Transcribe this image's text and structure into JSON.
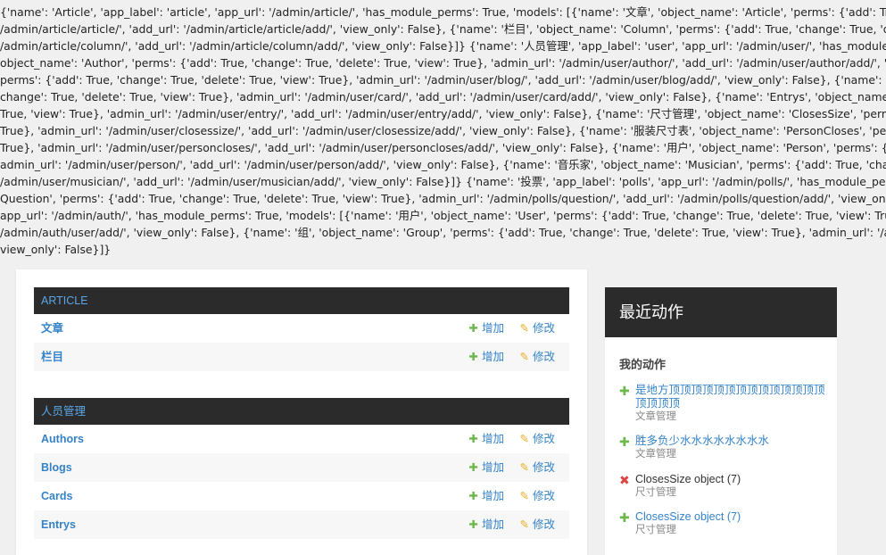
{
  "debug_dump": {
    "lines": [
      "{'name': 'Article', 'app_label': 'article', 'app_url': '/admin/article/', 'has_module_perms': True, 'models': [{'name': '文章', 'object_name': 'Article', 'perms': {'add': True, 'cha",
      "/admin/article/article/', 'add_url': '/admin/article/article/add/', 'view_only': False}, {'name': '栏目', 'object_name': 'Column', 'perms': {'add': True, 'change': True, 'delete",
      "/admin/article/column/', 'add_url': '/admin/article/column/add/', 'view_only': False}]} {'name': '人员管理', 'app_label': 'user', 'app_url': '/admin/user/', 'has_module_p",
      "object_name': 'Author', 'perms': {'add': True, 'change': True, 'delete': True, 'view': True}, 'admin_url': '/admin/user/author/', 'add_url': '/admin/user/author/add/', 'view_",
      "perms': {'add': True, 'change': True, 'delete': True, 'view': True}, 'admin_url': '/admin/user/blog/', 'add_url': '/admin/user/blog/add/', 'view_only': False}, {'name': 'Cards",
      "change': True, 'delete': True, 'view': True}, 'admin_url': '/admin/user/card/', 'add_url': '/admin/user/card/add/', 'view_only': False}, {'name': 'Entrys', 'object_name': 'Ent",
      "True, 'view': True}, 'admin_url': '/admin/user/entry/', 'add_url': '/admin/user/entry/add/', 'view_only': False}, {'name': '尺寸管理', 'object_name': 'ClosesSize', 'perms': {",
      "True}, 'admin_url': '/admin/user/closessize/', 'add_url': '/admin/user/closessize/add/', 'view_only': False}, {'name': '服装尺寸表', 'object_name': 'PersonCloses', 'perm",
      "True}, 'admin_url': '/admin/user/personcloses/', 'add_url': '/admin/user/personcloses/add/', 'view_only': False}, {'name': '用户', 'object_name': 'Person', 'perms': {'add",
      "admin_url': '/admin/user/person/', 'add_url': '/admin/user/person/add/', 'view_only': False}, {'name': '音乐家', 'object_name': 'Musician', 'perms': {'add': True, 'change",
      "/admin/user/musician/', 'add_url': '/admin/user/musician/add/', 'view_only': False}]} {'name': '投票', 'app_label': 'polls', 'app_url': '/admin/polls/', 'has_module_perm",
      "Question', 'perms': {'add': True, 'change': True, 'delete': True, 'view': True}, 'admin_url': '/admin/polls/question/', 'add_url': '/admin/polls/question/add/', 'view_only': F",
      "app_url': '/admin/auth/', 'has_module_perms': True, 'models': [{'name': '用户', 'object_name': 'User', 'perms': {'add': True, 'change': True, 'delete': True, 'view': True}, 'ad",
      "/admin/auth/user/add/', 'view_only': False}, {'name': '组', 'object_name': 'Group', 'perms': {'add': True, 'change': True, 'delete': True, 'view': True}, 'admin_url': '/admin/a",
      "view_only': False}]}"
    ]
  },
  "app_list": {
    "add_label": "增加",
    "change_label": "修改",
    "modules": [
      {
        "title": "ARTICLE",
        "models": [
          "文章",
          "栏目"
        ]
      },
      {
        "title": "人员管理",
        "models": [
          "Authors",
          "Blogs",
          "Cards",
          "Entrys"
        ]
      }
    ]
  },
  "recent_actions": {
    "title": "最近动作",
    "subtitle": "我的动作",
    "items": [
      {
        "kind": "add",
        "title": "是地方顶顶顶顶顶顶顶顶顶顶顶顶顶顶顶顶顶顶",
        "type": "文章管理"
      },
      {
        "kind": "add",
        "title": "胜多负少水水水水水水水水",
        "type": "文章管理"
      },
      {
        "kind": "delete",
        "title": "ClosesSize object (7)",
        "type": "尺寸管理"
      },
      {
        "kind": "add",
        "title": "ClosesSize object (7)",
        "type": "尺寸管理"
      }
    ]
  },
  "colors": {
    "header_bg": "#2b2b2b",
    "link": "#3483c9",
    "add_icon": "#6cb84c",
    "edit_icon": "#e8b12c",
    "delete_icon": "#dd4444"
  }
}
